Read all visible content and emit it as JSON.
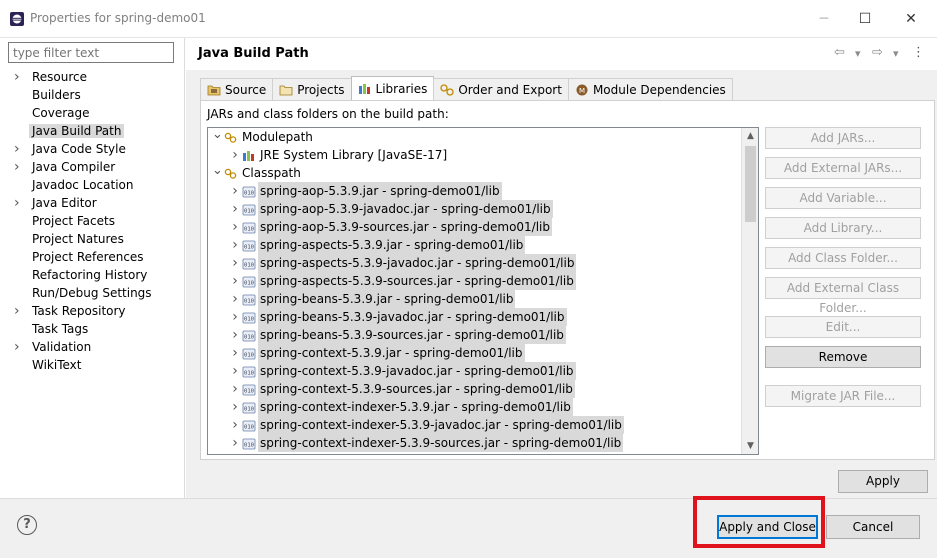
{
  "window": {
    "title": "Properties for spring-demo01",
    "controls": {
      "minimize": "─",
      "maximize": "☐",
      "close": "✕"
    }
  },
  "filter": {
    "placeholder": "type filter text"
  },
  "nav": {
    "items": [
      {
        "label": "Resource",
        "expandable": true
      },
      {
        "label": "Builders",
        "expandable": false
      },
      {
        "label": "Coverage",
        "expandable": false
      },
      {
        "label": "Java Build Path",
        "expandable": false,
        "selected": true
      },
      {
        "label": "Java Code Style",
        "expandable": true
      },
      {
        "label": "Java Compiler",
        "expandable": true
      },
      {
        "label": "Javadoc Location",
        "expandable": false
      },
      {
        "label": "Java Editor",
        "expandable": true
      },
      {
        "label": "Project Facets",
        "expandable": false
      },
      {
        "label": "Project Natures",
        "expandable": false
      },
      {
        "label": "Project References",
        "expandable": false
      },
      {
        "label": "Refactoring History",
        "expandable": false
      },
      {
        "label": "Run/Debug Settings",
        "expandable": false
      },
      {
        "label": "Task Repository",
        "expandable": true
      },
      {
        "label": "Task Tags",
        "expandable": false
      },
      {
        "label": "Validation",
        "expandable": true
      },
      {
        "label": "WikiText",
        "expandable": false
      }
    ]
  },
  "page": {
    "title": "Java Build Path",
    "nav_icons": {
      "back": "⇦",
      "forward": "⇨",
      "dropdown": "▾",
      "menu": "⋮"
    }
  },
  "tabs": [
    {
      "label": "Source",
      "icon": "source-folder-icon"
    },
    {
      "label": "Projects",
      "icon": "projects-folder-icon"
    },
    {
      "label": "Libraries",
      "icon": "libraries-icon",
      "active": true
    },
    {
      "label": "Order and Export",
      "icon": "order-export-icon"
    },
    {
      "label": "Module Dependencies",
      "icon": "module-icon"
    }
  ],
  "libraries": {
    "heading": "JARs and class folders on the build path:",
    "modulepath_label": "Modulepath",
    "jre_label": "JRE System Library [JavaSE-17]",
    "classpath_label": "Classpath",
    "jars": [
      "spring-aop-5.3.9.jar - spring-demo01/lib",
      "spring-aop-5.3.9-javadoc.jar - spring-demo01/lib",
      "spring-aop-5.3.9-sources.jar - spring-demo01/lib",
      "spring-aspects-5.3.9.jar - spring-demo01/lib",
      "spring-aspects-5.3.9-javadoc.jar - spring-demo01/lib",
      "spring-aspects-5.3.9-sources.jar - spring-demo01/lib",
      "spring-beans-5.3.9.jar - spring-demo01/lib",
      "spring-beans-5.3.9-javadoc.jar - spring-demo01/lib",
      "spring-beans-5.3.9-sources.jar - spring-demo01/lib",
      "spring-context-5.3.9.jar - spring-demo01/lib",
      "spring-context-5.3.9-javadoc.jar - spring-demo01/lib",
      "spring-context-5.3.9-sources.jar - spring-demo01/lib",
      "spring-context-indexer-5.3.9.jar - spring-demo01/lib",
      "spring-context-indexer-5.3.9-javadoc.jar - spring-demo01/lib",
      "spring-context-indexer-5.3.9-sources.jar - spring-demo01/lib"
    ],
    "buttons": {
      "add_jars": "Add JARs...",
      "add_external_jars": "Add External JARs...",
      "add_variable": "Add Variable...",
      "add_library": "Add Library...",
      "add_class_folder": "Add Class Folder...",
      "add_external_class_folder": "Add External Class Folder...",
      "edit": "Edit...",
      "remove": "Remove",
      "migrate_jar": "Migrate JAR File..."
    }
  },
  "apply_label": "Apply",
  "footer": {
    "help": "?",
    "apply_close": "Apply and Close",
    "cancel": "Cancel"
  },
  "colors": {
    "highlight": "#e0131d",
    "selection": "#d9d9d9",
    "default_button": "#0078d7"
  }
}
